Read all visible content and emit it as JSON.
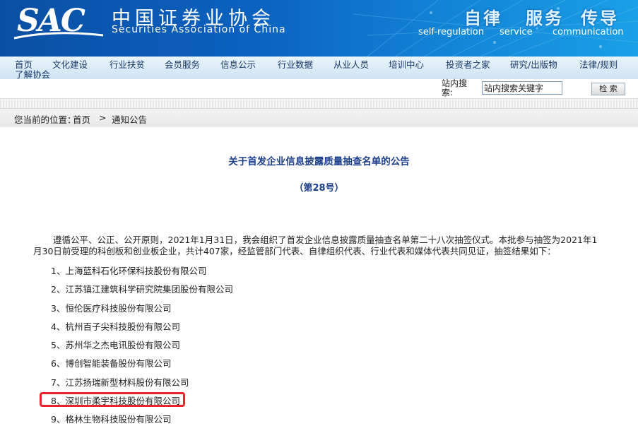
{
  "header": {
    "logo_text": "SAC",
    "cn_title": "中国证券业协会",
    "en_title": "Securities Association of China",
    "slogans": [
      {
        "cn": "自律",
        "en": "self-regulation"
      },
      {
        "cn": "服务",
        "en": "service"
      },
      {
        "cn": "传导",
        "en": "communication"
      }
    ]
  },
  "nav": {
    "items": [
      "首页",
      "文化建设",
      "行业扶贫",
      "会员服务",
      "信息公示",
      "行业数据",
      "从业人员",
      "培训中心",
      "投资者之家",
      "研究/出版物",
      "法律/规则",
      "了解协会"
    ]
  },
  "search": {
    "label": "站内搜索:",
    "value": "站内搜索关键字",
    "button": "检 索"
  },
  "breadcrumb": {
    "prefix": "您当前的位置：",
    "home": "首页",
    "separator": ">",
    "current": "通知公告"
  },
  "article": {
    "title": "关于首发企业信息披露质量抽查名单的公告",
    "subtitle": "（第28号）",
    "paragraph": "遵循公平、公正、公开原则，2021年1月31日，我会组织了首发企业信息披露质量抽查名单第二十八次抽签仪式。本批参与抽签为2021年1月30日前受理的科创板和创业板企业，共计407家，经监管部门代表、自律组织代表、行业代表和媒体代表共同见证，抽签结果如下：",
    "items": [
      "1、上海蓝科石化环保科技股份有限公司",
      "2、江苏镇江建筑科学研究院集团股份有限公司",
      "3、恒伦医疗科技股份有限公司",
      "4、杭州百子尖科技股份有限公司",
      "5、苏州华之杰电讯股份有限公司",
      "6、博创智能装备股份有限公司",
      "7、江苏扬瑞新型材料股份有限公司",
      "8、深圳市柔宇科技股份有限公司",
      "9、格林生物科技股份有限公司"
    ],
    "highlight_color": "#e8242c"
  }
}
